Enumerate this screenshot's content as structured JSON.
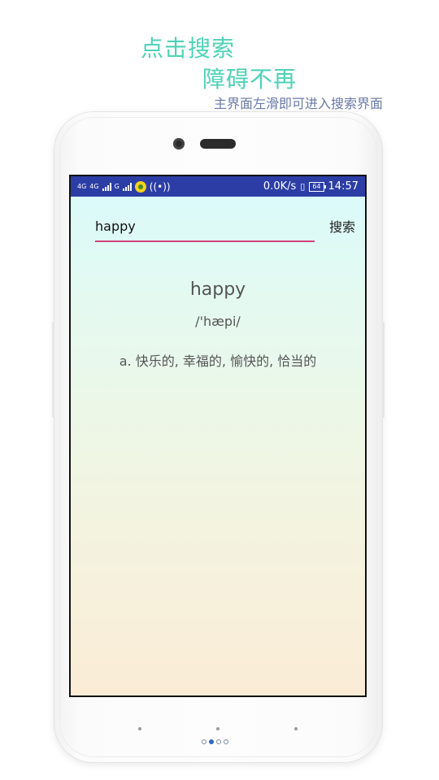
{
  "promo": {
    "line1": "点击搜索",
    "line2": "障碍不再",
    "line3": "主界面左滑即可进入搜索界面"
  },
  "status_bar": {
    "net_label": "4G",
    "signal1_label": "4G",
    "signal2_label": "G",
    "hotspot_icon": "wifi-hotspot-icon",
    "speed": "0.0K/s",
    "battery": "64",
    "time": "14:57"
  },
  "search": {
    "query": "happy",
    "button_label": "搜索"
  },
  "result": {
    "word": "happy",
    "phonetic": "/'hæpi/",
    "definition": "a. 快乐的, 幸福的, 愉快的, 恰当的"
  },
  "pager": {
    "count": 4,
    "active_index": 1
  },
  "colors": {
    "promo": "#4fd2b8",
    "status_bar": "#2c3ea6",
    "input_underline": "#d1417a"
  }
}
